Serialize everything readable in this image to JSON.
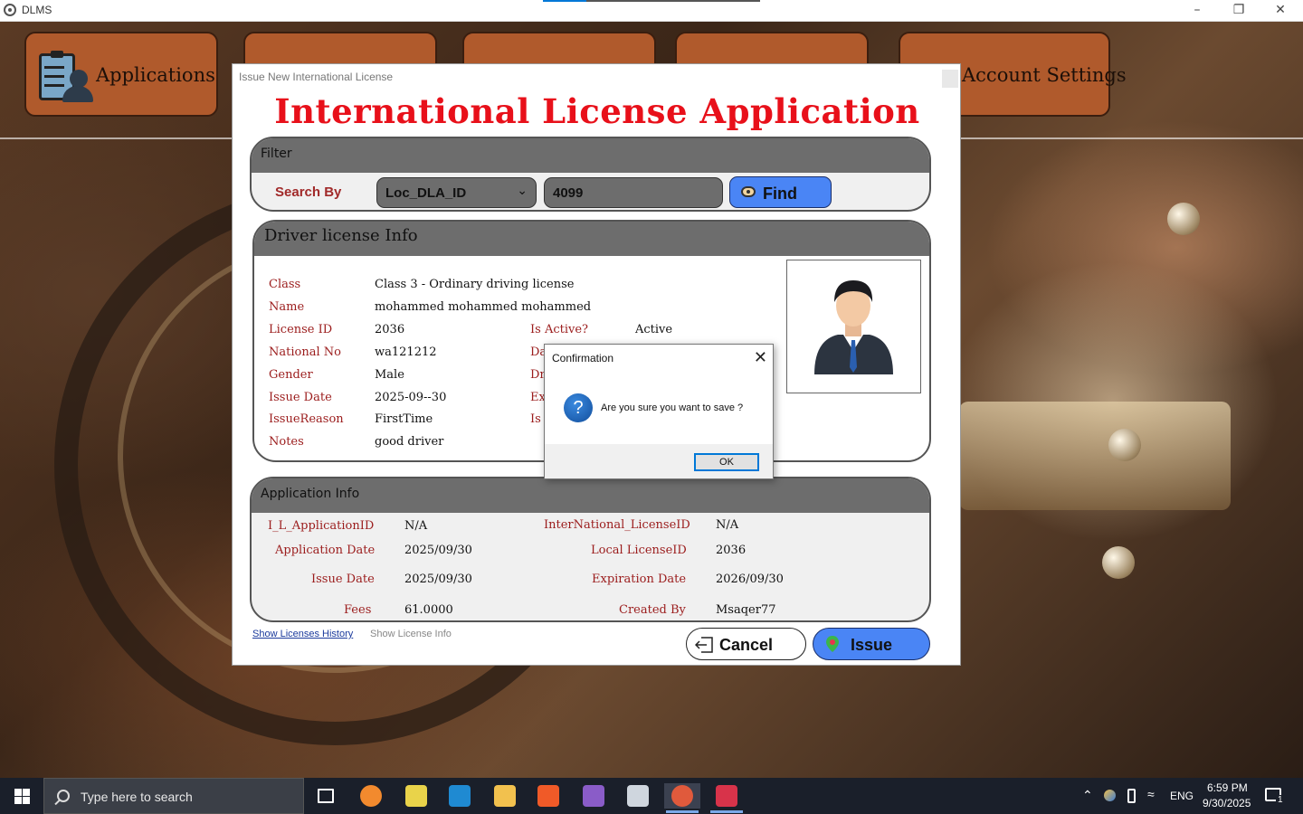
{
  "window": {
    "title": "DLMS"
  },
  "nav": [
    {
      "label": "Applications"
    },
    {
      "label": ""
    },
    {
      "label": ""
    },
    {
      "label": ""
    },
    {
      "label": "Account Settings"
    }
  ],
  "form": {
    "window_title": "Issue New International License",
    "heading": "International License Application",
    "filter": {
      "title": "Filter",
      "search_by_label": "Search By",
      "search_by_value": "Loc_DLA_ID",
      "search_value": "4099",
      "find_label": "Find"
    },
    "driver": {
      "title": "Driver license Info",
      "labels": {
        "class": "Class",
        "name": "Name",
        "license_id": "License ID",
        "national_no": "National No",
        "gender": "Gender",
        "issue_date": "Issue Date",
        "issue_reason": "IssueReason",
        "notes": "Notes",
        "is_active": "Is Active?",
        "date_partial": "Da",
        "driver_partial": "Dr",
        "expiry_partial": "Ex",
        "is_partial": "Is I"
      },
      "values": {
        "class": "Class 3 - Ordinary driving license",
        "name": "mohammed mohammed mohammed",
        "license_id": "2036",
        "national_no": "wa121212",
        "gender": "Male",
        "issue_date": "2025-09--30",
        "issue_reason": "FirstTime",
        "notes": "good driver",
        "is_active": "Active"
      }
    },
    "application": {
      "title": "Application Info",
      "labels": {
        "il_app_id": "I_L_ApplicationID",
        "app_date": "Application Date",
        "issue_date": "Issue Date",
        "fees": "Fees",
        "intl_license_id": "InterNational_LicenseID",
        "local_license_id": "Local LicenseID",
        "expiration_date": "Expiration Date",
        "created_by": "Created By"
      },
      "values": {
        "il_app_id": "N/A",
        "app_date": "2025/09/30",
        "issue_date": "2025/09/30",
        "fees": "61.0000",
        "intl_license_id": "N/A",
        "local_license_id": "2036",
        "expiration_date": "2026/09/30",
        "created_by": "Msaqer77"
      }
    },
    "links": {
      "history": "Show Licenses History",
      "info": "Show License Info"
    },
    "buttons": {
      "cancel": "Cancel",
      "issue": "Issue"
    }
  },
  "dialog": {
    "title": "Confirmation",
    "message": "Are you sure you want to save ?",
    "ok": "OK"
  },
  "taskbar": {
    "search_placeholder": "Type here to search",
    "language": "ENG",
    "time": "6:59 PM",
    "date": "9/30/2025",
    "notification_count": "1",
    "apps": [
      "task-view",
      "sublime",
      "sticky-notes",
      "vscode",
      "file-explorer",
      "brave",
      "visual-studio",
      "photos",
      "dlms-app",
      "snipping-tool"
    ]
  },
  "colors": {
    "accent": "#e8101a",
    "label_red": "#9b1c1c",
    "button_blue": "#4a85f5",
    "nav_orange": "#b05a2c"
  }
}
